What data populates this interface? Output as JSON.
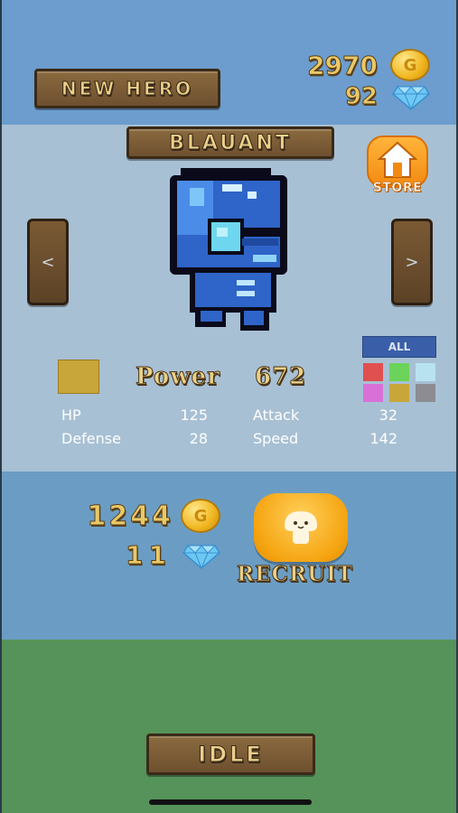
{
  "header": {
    "new_hero_label": "NEW HERO",
    "gold": "2970",
    "gems": "92",
    "coin_glyph": "G"
  },
  "hero": {
    "name": "BLAUANT",
    "prev_label": "<",
    "next_label": ">",
    "power_label": "Power",
    "power_value": "672",
    "color": "#c9a63a",
    "stats": [
      {
        "label": "HP",
        "value": "125"
      },
      {
        "label": "Attack",
        "value": "32"
      },
      {
        "label": "Defense",
        "value": "28"
      },
      {
        "label": "Speed",
        "value": "142"
      }
    ]
  },
  "store": {
    "label": "STORE"
  },
  "filter": {
    "all_label": "ALL",
    "colors": [
      "#e05050",
      "#6cd35a",
      "#b8e2f0",
      "#d870d8",
      "#c9a63a",
      "#8c8c92"
    ]
  },
  "recruit": {
    "cost_gold": "1244",
    "cost_gems": "11",
    "label": "RECRUIT"
  },
  "footer": {
    "idle_label": "IDLE"
  }
}
